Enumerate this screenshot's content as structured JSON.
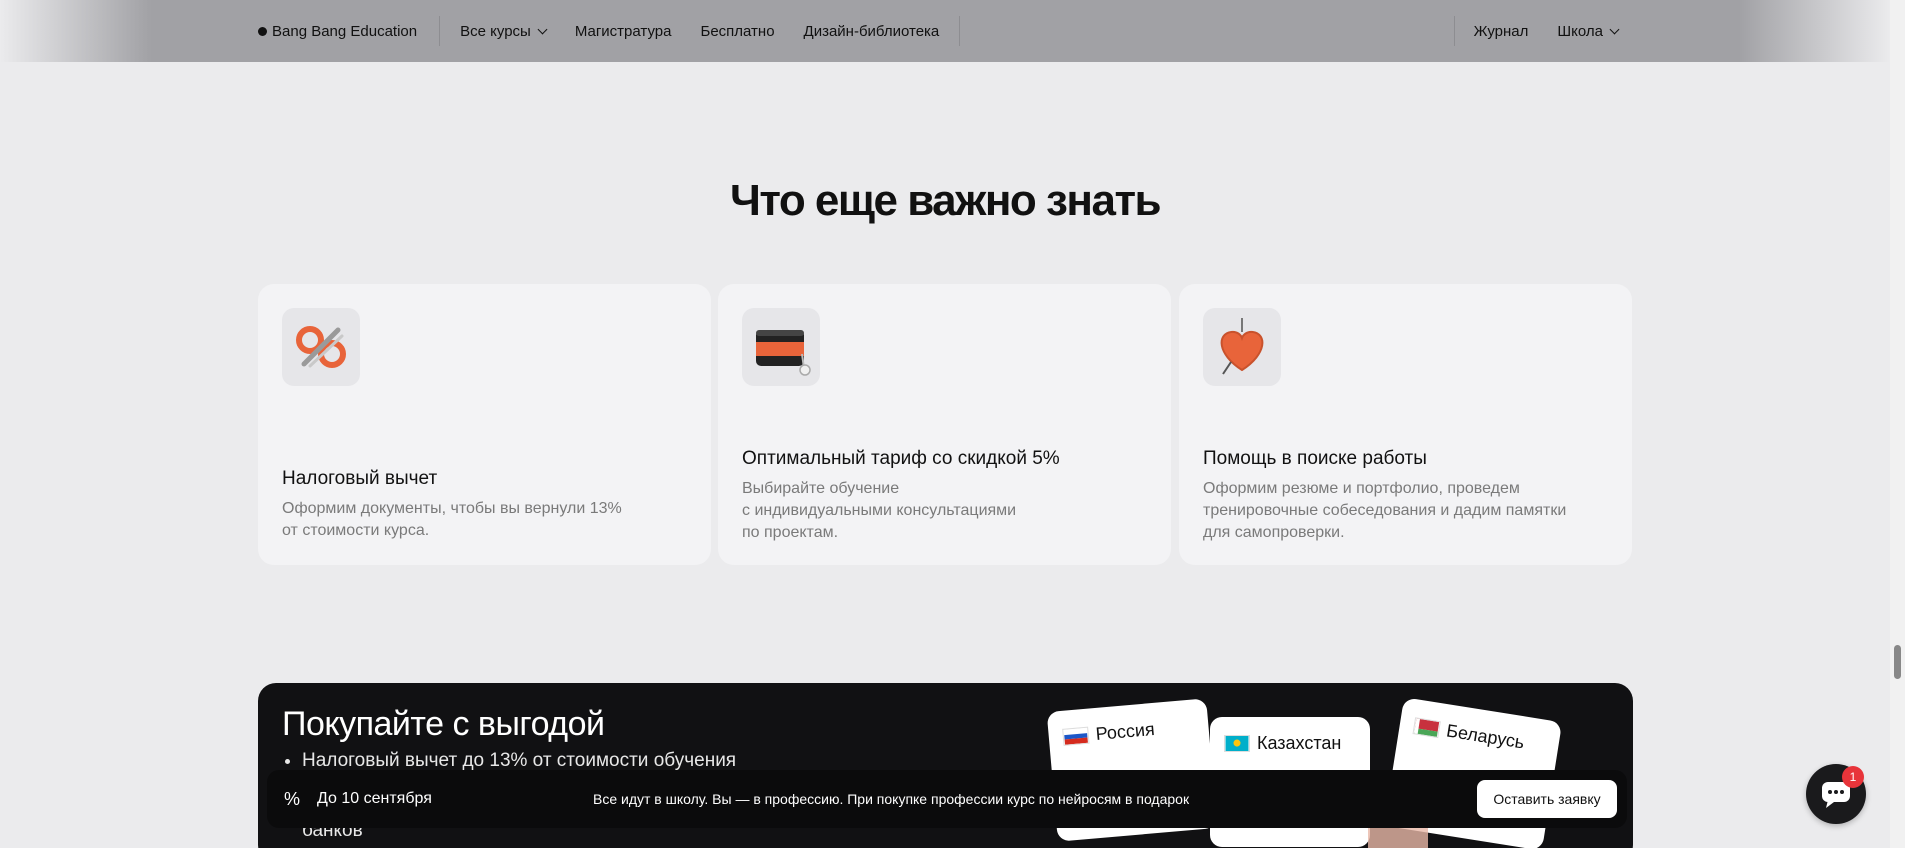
{
  "nav": {
    "brand": "Bang Bang Education",
    "links": [
      "Все курсы",
      "Магистратура",
      "Бесплатно",
      "Дизайн-библиотека"
    ],
    "right_links": [
      "Журнал",
      "Школа"
    ]
  },
  "section": {
    "title": "Что еще важно знать"
  },
  "cards": [
    {
      "title": "Налоговый вычет",
      "text": "Оформим документы, чтобы вы вернули 13%\nот стоимости курса.",
      "icon": "percent-icon"
    },
    {
      "title": "Оптимальный тариф со скидкой 5%",
      "text": "Выбирайте обучение\nс индивидуальными консультациями\nпо проектам.",
      "icon": "wallet-icon"
    },
    {
      "title": "Помощь в поиске работы",
      "text": "Оформим резюме и портфолио, проведем\nтренировочные собеседования и дадим памятки\nдля самопроверки.",
      "icon": "heart-icon"
    }
  ],
  "promo": {
    "title": "Покупайте с выгодой",
    "items": [
      "Налоговый вычет до 13% от стоимости обучения"
    ],
    "tail": "банков",
    "countries": [
      "Россия",
      "Казахстан",
      "Беларусь"
    ]
  },
  "bar": {
    "icon": "%",
    "date": "До 10 сентября",
    "message": "Все идут в школу. Вы — в профессию. При покупке профессии курс по нейросям в подарок",
    "button": "Оставить заявку"
  },
  "chat": {
    "badge": "1"
  },
  "colors": {
    "background": "#ebebed",
    "card": "#f3f3f5",
    "dark": "#111113",
    "accent": "#e8643a",
    "badge": "#e8343a"
  }
}
